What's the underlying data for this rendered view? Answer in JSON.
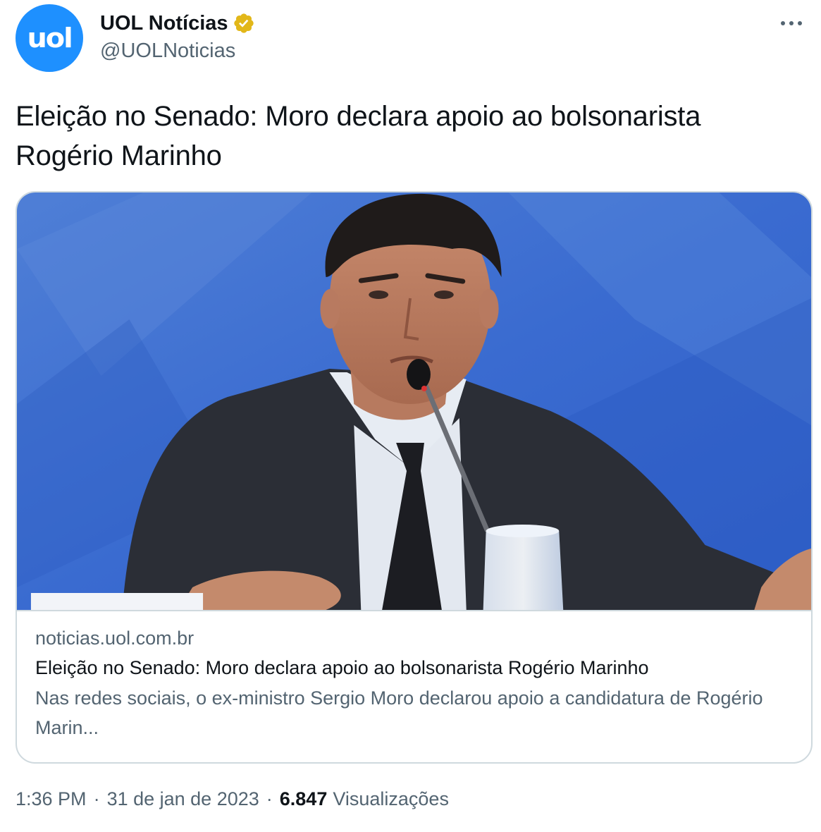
{
  "author": {
    "display_name": "UOL Notícias",
    "handle": "@UOLNoticias",
    "avatar_text": "uol",
    "avatar_color": "#1e90ff",
    "verified_badge": "gold-verified-badge-icon",
    "verified_color": "#e2b719"
  },
  "menu": {
    "icon": "more-horizontal-icon"
  },
  "tweet": {
    "text": "Eleição no Senado: Moro declara apoio ao bolsonarista Rogério Marinho"
  },
  "card": {
    "domain": "noticias.uol.com.br",
    "title": "Eleição no Senado: Moro declara apoio ao bolsonarista Rogério Marinho",
    "description": "Nas redes sociais, o ex-ministro Sergio Moro declarou apoio a candidatura de Rogério Marin..."
  },
  "meta": {
    "time": "1:36 PM",
    "separator": "·",
    "date": "31 de jan de 2023",
    "views_count": "6.847",
    "views_label": "Visualizações"
  },
  "colors": {
    "text_primary": "#0f1419",
    "text_secondary": "#536471",
    "border": "#cfd9de",
    "photo_background": "#3f6fd0"
  }
}
